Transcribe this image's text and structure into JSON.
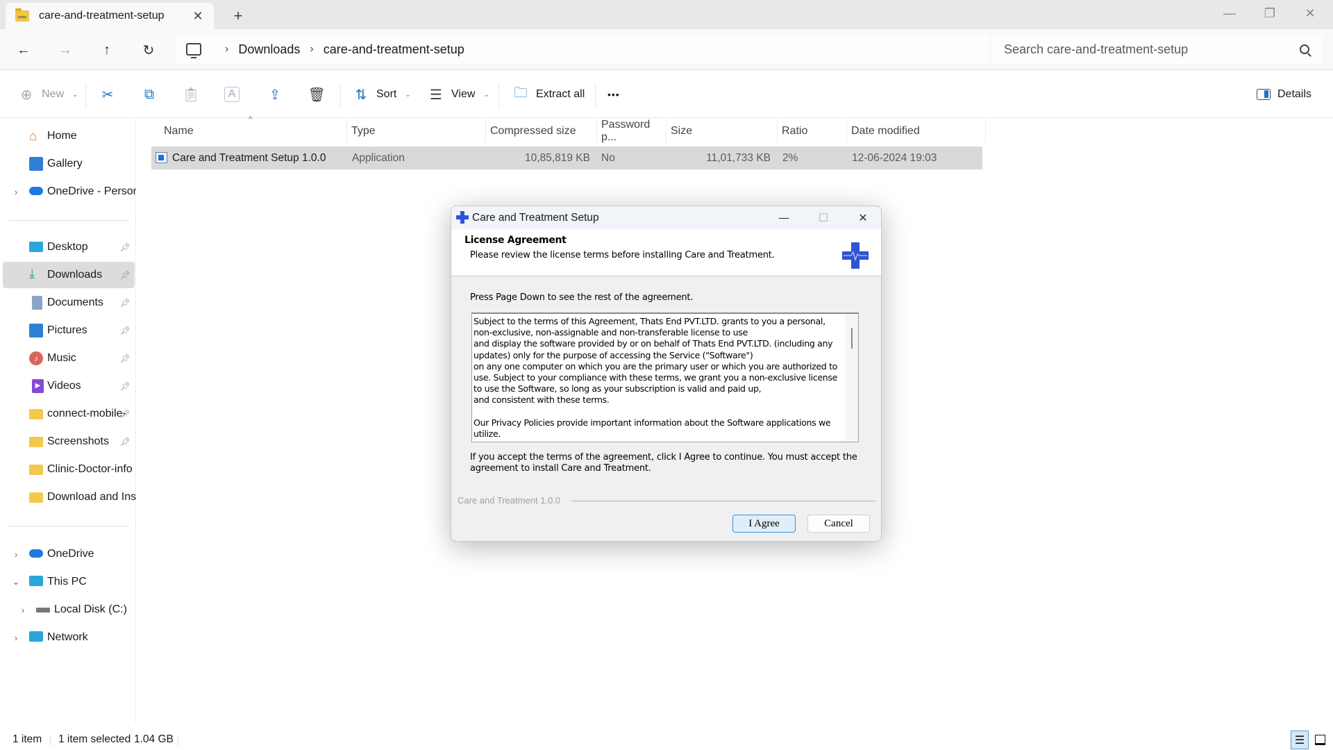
{
  "window": {
    "tab_title": "care-and-treatment-setup",
    "tab_close_icon": "close-icon",
    "new_tab_icon": "plus-icon",
    "controls": {
      "minimize": "—",
      "restore": "❐",
      "close": "✕"
    }
  },
  "nav": {
    "back": "←",
    "forward": "→",
    "up": "↑",
    "refresh": "↻"
  },
  "breadcrumb": {
    "items": [
      "Downloads",
      "care-and-treatment-setup"
    ],
    "separator": "›"
  },
  "search": {
    "placeholder": "Search care-and-treatment-setup",
    "value": ""
  },
  "toolbar": {
    "new_label": "New",
    "sort_label": "Sort",
    "view_label": "View",
    "extract_all_label": "Extract all",
    "more_label": "•••",
    "details_label": "Details"
  },
  "sidebar": {
    "top": [
      {
        "label": "Home"
      },
      {
        "label": "Gallery"
      },
      {
        "label": "OneDrive - Personal",
        "expander": "›"
      }
    ],
    "quick_access": [
      {
        "label": "Desktop",
        "pinned": true
      },
      {
        "label": "Downloads",
        "pinned": true,
        "selected": true
      },
      {
        "label": "Documents",
        "pinned": true
      },
      {
        "label": "Pictures",
        "pinned": true
      },
      {
        "label": "Music",
        "pinned": true
      },
      {
        "label": "Videos",
        "pinned": true
      },
      {
        "label": "connect-mobile-",
        "pinned": true
      },
      {
        "label": "Screenshots",
        "pinned": true
      },
      {
        "label": "Clinic-Doctor-info",
        "pinned": false
      },
      {
        "label": "Download and Install",
        "pinned": false
      }
    ],
    "bottom": [
      {
        "label": "OneDrive",
        "expander": "›"
      },
      {
        "label": "This PC",
        "expander": "⌄"
      },
      {
        "label": "Local Disk (C:)",
        "expander": "›"
      },
      {
        "label": "Network",
        "expander": "›"
      }
    ]
  },
  "file_list": {
    "columns": [
      "Name",
      "Type",
      "Compressed size",
      "Password p...",
      "Size",
      "Ratio",
      "Date modified"
    ],
    "rows": [
      {
        "name": "Care and Treatment Setup 1.0.0",
        "type": "Application",
        "compressed_size": "10,85,819 KB",
        "password_protected": "No",
        "size": "11,01,733 KB",
        "ratio": "2%",
        "date_modified": "12-06-2024 19:03"
      }
    ]
  },
  "statusbar": {
    "item_count": "1 item",
    "selection": "1 item selected",
    "selection_size": "1.04 GB"
  },
  "dialog": {
    "title": "Care and Treatment Setup",
    "header_title": "License Agreement",
    "header_subtitle": "Please review the license terms before installing Care and Treatment.",
    "instruction": "Press Page Down to see the rest of the agreement.",
    "license_text": "Subject to the terms of this Agreement, Thats End PVT.LTD. grants to you a personal,\nnon-exclusive, non-assignable and non-transferable license to use\nand display the software provided by or on behalf of Thats End PVT.LTD. (including any\nupdates) only for the purpose of accessing the Service (\"Software\")\non any one computer on which you are the primary user or which you are authorized to\nuse. Subject to your compliance with these terms, we grant you a non-exclusive license\nto use the Software, so long as your subscription is valid and paid up,\nand consistent with these terms.\n\nOur Privacy Policies provide important information about the Software applications we\nutilize.",
    "accept_text": "If you accept the terms of the agreement, click I Agree to continue. You must accept the agreement to install Care and Treatment.",
    "branding": "Care and Treatment 1.0.0",
    "agree_label": "I Agree",
    "cancel_label": "Cancel",
    "controls": {
      "minimize": "—",
      "maximize": "☐",
      "close": "✕"
    },
    "accent_color": "#2f55d4"
  },
  "colors": {
    "selection": "#d9d9d9",
    "accent": "#1e73c8"
  }
}
